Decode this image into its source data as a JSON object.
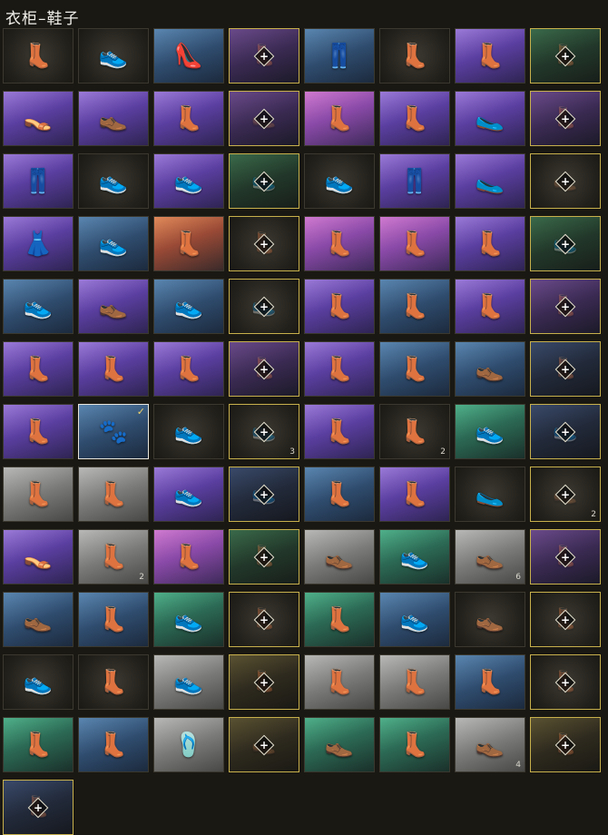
{
  "header": {
    "title": "衣柜–鞋子"
  },
  "lock_glyph": "+",
  "check_glyph": "✓",
  "items": [
    {
      "bg": "dark",
      "icon": "combat-boots-icon",
      "glyph": "👢",
      "color": "#bdb9ae",
      "locked": false
    },
    {
      "bg": "dark",
      "icon": "sneakers-icon",
      "glyph": "👟",
      "color": "#e88a3a",
      "locked": false
    },
    {
      "bg": "blue",
      "icon": "flats-icon",
      "glyph": "👠",
      "color": "#f0b8c8",
      "locked": false
    },
    {
      "bg": "darkpurple",
      "icon": "ankle-boots-icon",
      "glyph": "👢",
      "color": "#6a5a5a",
      "locked": true
    },
    {
      "bg": "blue",
      "icon": "legwear-icon",
      "glyph": "👖",
      "color": "#9aa4b0",
      "locked": false
    },
    {
      "bg": "dark",
      "icon": "work-boots-icon",
      "glyph": "👢",
      "color": "#c89a4a",
      "locked": false
    },
    {
      "bg": "purple",
      "icon": "pink-boots-icon",
      "glyph": "👢",
      "color": "#f0a8d8",
      "locked": false
    },
    {
      "bg": "darkgreen",
      "icon": "green-boots-icon",
      "glyph": "👢",
      "color": "#4a8a6a",
      "locked": true
    },
    {
      "bg": "purple",
      "icon": "sandals-icon",
      "glyph": "👡",
      "color": "#e0b08a",
      "locked": false
    },
    {
      "bg": "purple",
      "icon": "brown-boots-icon",
      "glyph": "👞",
      "color": "#8a5a3a",
      "locked": false
    },
    {
      "bg": "purple",
      "icon": "tall-boots-icon",
      "glyph": "👢",
      "color": "#3a3a3a",
      "locked": false
    },
    {
      "bg": "darkpurple",
      "icon": "red-shoes-icon",
      "glyph": "👞",
      "color": "#8a3a3a",
      "locked": true
    },
    {
      "bg": "pink",
      "icon": "pink-stockings-icon",
      "glyph": "👢",
      "color": "#f0a8c0",
      "locked": false
    },
    {
      "bg": "purple",
      "icon": "pink-knee-boots-icon",
      "glyph": "👢",
      "color": "#f0b0c0",
      "locked": false
    },
    {
      "bg": "purple",
      "icon": "slippers-icon",
      "glyph": "🥿",
      "color": "#f0d0b0",
      "locked": false
    },
    {
      "bg": "darkpurple",
      "icon": "dark-boots-icon",
      "glyph": "👢",
      "color": "#4a3a4a",
      "locked": true
    },
    {
      "bg": "purple",
      "icon": "camo-leggings-icon",
      "glyph": "👖",
      "color": "#6a5a4a",
      "locked": false
    },
    {
      "bg": "dark",
      "icon": "purple-sneakers-icon",
      "glyph": "👟",
      "color": "#8a5ac8",
      "locked": false
    },
    {
      "bg": "purple",
      "icon": "white-sneakers-icon",
      "glyph": "👟",
      "color": "#e0e0e0",
      "locked": false
    },
    {
      "bg": "darkgreen",
      "icon": "green-sneakers-icon",
      "glyph": "👟",
      "color": "#3a6a3a",
      "locked": true
    },
    {
      "bg": "dark",
      "icon": "lime-sneakers-icon",
      "glyph": "👟",
      "color": "#a8e83a",
      "locked": false
    },
    {
      "bg": "purple",
      "icon": "leather-pants-icon",
      "glyph": "👖",
      "color": "#2a2a3a",
      "locked": false
    },
    {
      "bg": "purple",
      "icon": "pink-slippers-icon",
      "glyph": "🥿",
      "color": "#f09ab0",
      "locked": false
    },
    {
      "bg": "dark",
      "icon": "black-shoes-icon",
      "glyph": "👞",
      "color": "#4a4a4a",
      "locked": true
    },
    {
      "bg": "purple",
      "icon": "blue-dress-icon",
      "glyph": "👗",
      "color": "#5a9ae8",
      "locked": false
    },
    {
      "bg": "blue",
      "icon": "red-sneakers-icon",
      "glyph": "👟",
      "color": "#c86a3a",
      "locked": false
    },
    {
      "bg": "orange",
      "icon": "thigh-boots-icon",
      "glyph": "👢",
      "color": "#5a3a2a",
      "locked": false
    },
    {
      "bg": "dark",
      "icon": "black-tall-boots-icon",
      "glyph": "👢",
      "color": "#3a2a2a",
      "locked": true
    },
    {
      "bg": "pink",
      "icon": "black-boots-icon",
      "glyph": "👢",
      "color": "#2a2a2a",
      "locked": false
    },
    {
      "bg": "pink",
      "icon": "maroon-boots-icon",
      "glyph": "👢",
      "color": "#6a2a2a",
      "locked": false
    },
    {
      "bg": "purple",
      "icon": "brown-knee-boots-icon",
      "glyph": "👢",
      "color": "#5a3a3a",
      "locked": false
    },
    {
      "bg": "darkgreen",
      "icon": "dark-sneakers-icon",
      "glyph": "👟",
      "color": "#2a3a2a",
      "locked": true
    },
    {
      "bg": "blue",
      "icon": "beige-sneakers-icon",
      "glyph": "👟",
      "color": "#e8d8b0",
      "locked": false
    },
    {
      "bg": "purple",
      "icon": "sock-shoes-icon",
      "glyph": "👞",
      "color": "#8a4a3a",
      "locked": false
    },
    {
      "bg": "blue",
      "icon": "black-high-tops-icon",
      "glyph": "👟",
      "color": "#1a1a1a",
      "locked": false
    },
    {
      "bg": "dark",
      "icon": "red-high-tops-icon",
      "glyph": "👟",
      "color": "#8a3a3a",
      "locked": true
    },
    {
      "bg": "purple",
      "icon": "studded-boots-icon",
      "glyph": "👢",
      "color": "#8a5a2a",
      "locked": false
    },
    {
      "bg": "blue",
      "icon": "white-tall-boots-icon",
      "glyph": "👢",
      "color": "#d0d0d0",
      "locked": false
    },
    {
      "bg": "purple",
      "icon": "red-combat-boots-icon",
      "glyph": "👢",
      "color": "#8a2a3a",
      "locked": false
    },
    {
      "bg": "darkpurple",
      "icon": "black-knee-boots-icon",
      "glyph": "👢",
      "color": "#1a1a1a",
      "locked": true
    },
    {
      "bg": "purple",
      "icon": "wrap-boots-icon",
      "glyph": "👢",
      "color": "#e0e0e0",
      "locked": false
    },
    {
      "bg": "purple",
      "icon": "lace-stockings-icon",
      "glyph": "👢",
      "color": "#2a2a2a",
      "locked": false
    },
    {
      "bg": "purple",
      "icon": "buckle-boots-icon",
      "glyph": "👢",
      "color": "#3a2a2a",
      "locked": false
    },
    {
      "bg": "darkpurple",
      "icon": "strap-boots-icon",
      "glyph": "👢",
      "color": "#3a3a3a",
      "locked": true
    },
    {
      "bg": "purple",
      "icon": "heeled-boots-icon",
      "glyph": "👢",
      "color": "#1a1a1a",
      "locked": false
    },
    {
      "bg": "blue",
      "icon": "brown-ankle-boots-icon",
      "glyph": "👢",
      "color": "#5a3a2a",
      "locked": false
    },
    {
      "bg": "blue",
      "icon": "low-boots-icon",
      "glyph": "👞",
      "color": "#3a2a2a",
      "locked": false
    },
    {
      "bg": "darkblue",
      "icon": "slim-boots-icon",
      "glyph": "👢",
      "color": "#1a1a1a",
      "locked": true
    },
    {
      "bg": "purple",
      "icon": "laced-tall-boots-icon",
      "glyph": "👢",
      "color": "#5a2a2a",
      "locked": false
    },
    {
      "bg": "blue",
      "icon": "paw-slippers-icon",
      "glyph": "🐾",
      "color": "#f0f0f0",
      "locked": false,
      "selected": true
    },
    {
      "bg": "dark",
      "icon": "orange-sneakers-icon",
      "glyph": "👟",
      "color": "#c86a4a",
      "locked": false
    },
    {
      "bg": "dark",
      "icon": "gray-sneakers-icon",
      "glyph": "👟",
      "color": "#4a4a4a",
      "locked": true,
      "count": "3"
    },
    {
      "bg": "purple",
      "icon": "black-work-boots-icon",
      "glyph": "👢",
      "color": "#2a2a2a",
      "locked": false
    },
    {
      "bg": "dark",
      "icon": "gray-ankle-boots-icon",
      "glyph": "👢",
      "color": "#5a5a5a",
      "locked": false,
      "count": "2"
    },
    {
      "bg": "green",
      "icon": "white-trainers-icon",
      "glyph": "👟",
      "color": "#f0f0f0",
      "locked": false
    },
    {
      "bg": "darkblue",
      "icon": "red-trim-sneakers-icon",
      "glyph": "👟",
      "color": "#8a2a3a",
      "locked": true
    },
    {
      "bg": "gray",
      "icon": "gray-combat-boots-icon",
      "glyph": "👢",
      "color": "#e0e0e0",
      "locked": false
    },
    {
      "bg": "gray",
      "icon": "navy-boots-icon",
      "glyph": "👢",
      "color": "#2a3a5a",
      "locked": false
    },
    {
      "bg": "purple",
      "icon": "pink-trainers-icon",
      "glyph": "👟",
      "color": "#f0c0d0",
      "locked": false
    },
    {
      "bg": "darkblue",
      "icon": "blue-sneakers-icon",
      "glyph": "👟",
      "color": "#2a3a4a",
      "locked": true
    },
    {
      "bg": "blue",
      "icon": "platform-boots-icon",
      "glyph": "👢",
      "color": "#d0d0d0",
      "locked": false
    },
    {
      "bg": "purple",
      "icon": "patterned-boots-icon",
      "glyph": "👢",
      "color": "#3a3a3a",
      "locked": false
    },
    {
      "bg": "dark",
      "icon": "teal-slippers-icon",
      "glyph": "🥿",
      "color": "#5ac8d0",
      "locked": false
    },
    {
      "bg": "dark",
      "icon": "dark-loafers-icon",
      "glyph": "👞",
      "color": "#3a3a3a",
      "locked": true,
      "count": "2"
    },
    {
      "bg": "purple",
      "icon": "slide-sandals-icon",
      "glyph": "👡",
      "color": "#e0a070",
      "locked": false
    },
    {
      "bg": "gray",
      "icon": "brown-work-boots-icon",
      "glyph": "👢",
      "color": "#4a2a1a",
      "locked": false,
      "count": "2"
    },
    {
      "bg": "pink",
      "icon": "black-riding-boots-icon",
      "glyph": "👢",
      "color": "#1a1a1a",
      "locked": false
    },
    {
      "bg": "darkgreen",
      "icon": "dark-work-boots-icon",
      "glyph": "👢",
      "color": "#2a3a2a",
      "locked": true
    },
    {
      "bg": "gray",
      "icon": "tan-boots-icon",
      "glyph": "👞",
      "color": "#c88a4a",
      "locked": false
    },
    {
      "bg": "green",
      "icon": "orange-trainers-icon",
      "glyph": "👟",
      "color": "#e08a3a",
      "locked": false
    },
    {
      "bg": "gray",
      "icon": "brown-oxfords-icon",
      "glyph": "👞",
      "color": "#8a4a2a",
      "locked": false,
      "count": "6"
    },
    {
      "bg": "darkpurple",
      "icon": "fur-boots-icon",
      "glyph": "👢",
      "color": "#6a5a5a",
      "locked": true
    },
    {
      "bg": "blue",
      "icon": "yellow-boots-icon",
      "glyph": "👞",
      "color": "#e0a83a",
      "locked": false
    },
    {
      "bg": "blue",
      "icon": "black-buckle-boots-icon",
      "glyph": "👢",
      "color": "#1a1a1a",
      "locked": false
    },
    {
      "bg": "green",
      "icon": "red-high-tops-icon",
      "glyph": "👟",
      "color": "#c83a3a",
      "locked": false
    },
    {
      "bg": "dark",
      "icon": "black-combat-boots-icon",
      "glyph": "👢",
      "color": "#1a1a1a",
      "locked": true
    },
    {
      "bg": "green",
      "icon": "black-tall-boots-icon",
      "glyph": "👢",
      "color": "#1a1a1a",
      "locked": false
    },
    {
      "bg": "blue",
      "icon": "green-sneakers-icon",
      "glyph": "👟",
      "color": "#5aa83a",
      "locked": false
    },
    {
      "bg": "dark",
      "icon": "black-dress-shoes-icon",
      "glyph": "👞",
      "color": "#1a1a2a",
      "locked": false
    },
    {
      "bg": "dark",
      "icon": "shadow-boots-icon",
      "glyph": "👢",
      "color": "#2a2a2a",
      "locked": true
    },
    {
      "bg": "dark",
      "icon": "gray-trainers-icon",
      "glyph": "👟",
      "color": "#b0b0b0",
      "locked": false
    },
    {
      "bg": "dark",
      "icon": "slate-boots-icon",
      "glyph": "👢",
      "color": "#5a6a7a",
      "locked": false
    },
    {
      "bg": "gray",
      "icon": "white-high-tops-icon",
      "glyph": "👟",
      "color": "#e0e0e0",
      "locked": false
    },
    {
      "bg": "gold",
      "icon": "brown-boots-icon",
      "glyph": "👢",
      "color": "#5a3a1a",
      "locked": true
    },
    {
      "bg": "gray",
      "icon": "black-lace-boots-icon",
      "glyph": "👢",
      "color": "#2a2a2a",
      "locked": false
    },
    {
      "bg": "gray",
      "icon": "orange-tall-boots-icon",
      "glyph": "👢",
      "color": "#c8702a",
      "locked": false
    },
    {
      "bg": "blue",
      "icon": "gray-lace-boots-icon",
      "glyph": "👢",
      "color": "#5a5a5a",
      "locked": false
    },
    {
      "bg": "dark",
      "icon": "black-riding-boots-icon",
      "glyph": "👢",
      "color": "#1a1a1a",
      "locked": true
    },
    {
      "bg": "green",
      "icon": "camo-boots-icon",
      "glyph": "👢",
      "color": "#6a7a4a",
      "locked": false
    },
    {
      "bg": "blue",
      "icon": "red-heeled-boots-icon",
      "glyph": "👢",
      "color": "#b02a2a",
      "locked": false
    },
    {
      "bg": "gray",
      "icon": "flip-flops-icon",
      "glyph": "🩴",
      "color": "#c8b89a",
      "locked": false
    },
    {
      "bg": "gold",
      "icon": "red-shoes-icon",
      "glyph": "👞",
      "color": "#a02a2a",
      "locked": true
    },
    {
      "bg": "green",
      "icon": "khaki-shoes-icon",
      "glyph": "👞",
      "color": "#a88a5a",
      "locked": false
    },
    {
      "bg": "green",
      "icon": "camo-work-boots-icon",
      "glyph": "👢",
      "color": "#4a4a3a",
      "locked": false
    },
    {
      "bg": "gray",
      "icon": "brown-dress-shoes-icon",
      "glyph": "👞",
      "color": "#5a3a2a",
      "locked": false,
      "count": "4"
    },
    {
      "bg": "gold",
      "icon": "black-lace-up-boots-icon",
      "glyph": "👢",
      "color": "#2a2a2a",
      "locked": true
    },
    {
      "bg": "darkblue",
      "icon": "mystery-boots-icon",
      "glyph": "👢",
      "color": "#2a2a3a",
      "locked": true
    }
  ]
}
